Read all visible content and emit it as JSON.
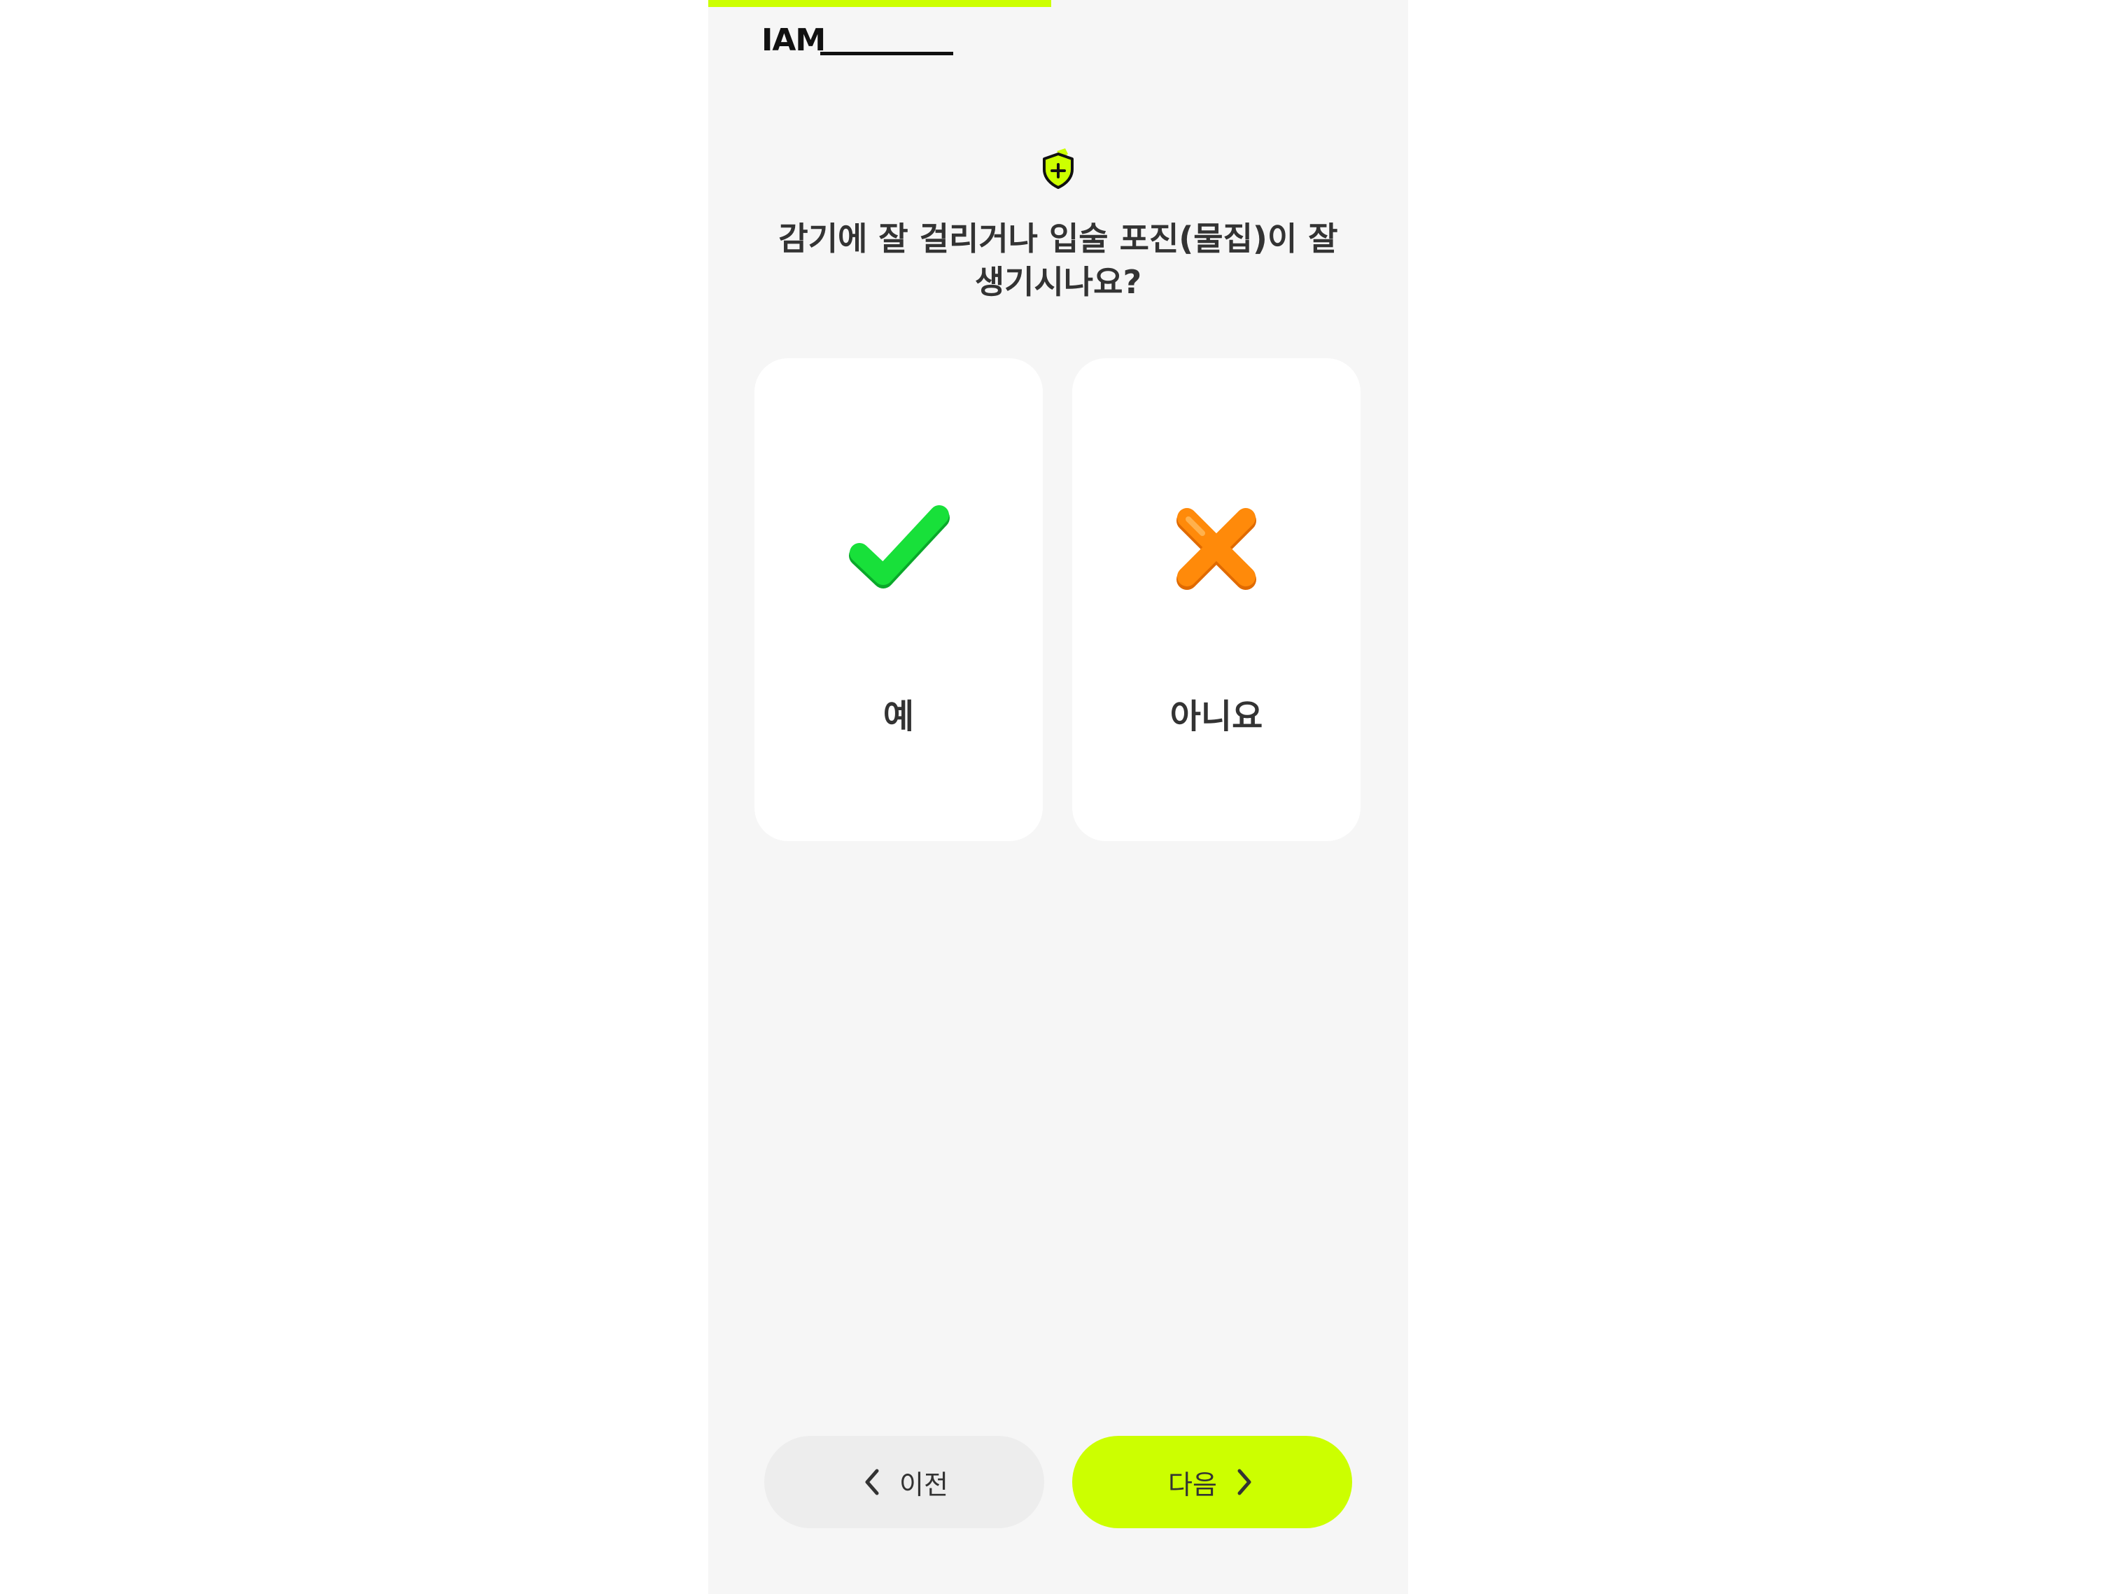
{
  "header": {
    "logo_text": "IAM",
    "progress_fraction": 0.49
  },
  "question": {
    "line1": "감기에 잘 걸리거나 입술 포진(물집)이 잘",
    "line2": "생기시나요?",
    "icon": "shield-plus-icon"
  },
  "options": [
    {
      "label": "예",
      "icon": "checkmark-icon",
      "color": "#18e03a"
    },
    {
      "label": "아니요",
      "icon": "x-cross-icon",
      "color": "#ff8a0a"
    }
  ],
  "navigation": {
    "prev_label": "이전",
    "next_label": "다음",
    "accent_color": "#ccff00"
  }
}
